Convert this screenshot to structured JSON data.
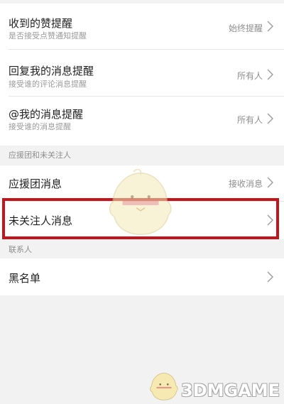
{
  "settings": {
    "rows": [
      {
        "title": "收到的赞提醒",
        "subtitle": "是否接受点赞通知提醒",
        "value": "始终提醒"
      },
      {
        "title": "回复我的消息提醒",
        "subtitle": "接受谁的评论消息提醒",
        "value": "所有人"
      },
      {
        "title": "@我的消息提醒",
        "subtitle": "接受谁的消息提醒",
        "value": "所有人"
      }
    ]
  },
  "section_fans": {
    "label": "应援团和未关注人",
    "rows": [
      {
        "title": "应援团消息",
        "value": "接收消息"
      },
      {
        "title": "未关注人消息",
        "value": ""
      }
    ]
  },
  "section_contacts": {
    "label": "联系人",
    "rows": [
      {
        "title": "黑名单",
        "value": ""
      }
    ]
  },
  "watermark": {
    "text": "3DMGAME",
    "icon": "chick-mascot-icon"
  },
  "colors": {
    "highlight": "#c4141b",
    "background": "#f2f2f2",
    "card": "#ffffff"
  }
}
